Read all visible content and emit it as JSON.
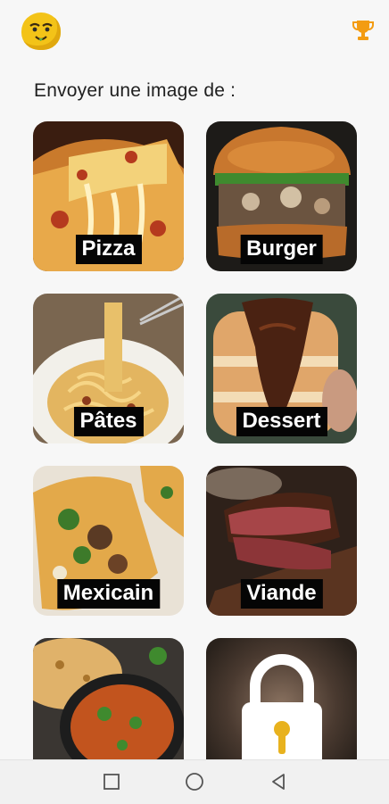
{
  "header": {
    "avatar_icon": "emoji-face-icon",
    "trophy_icon": "trophy-icon",
    "accent_color": "#f39c12"
  },
  "heading": "Envoyer une image de :",
  "categories": [
    {
      "label": "Pizza",
      "locked": false
    },
    {
      "label": "Burger",
      "locked": false
    },
    {
      "label": "Pâtes",
      "locked": false
    },
    {
      "label": "Dessert",
      "locked": false
    },
    {
      "label": "Mexicain",
      "locked": false
    },
    {
      "label": "Viande",
      "locked": false
    },
    {
      "label": "",
      "locked": false
    },
    {
      "label": "",
      "locked": true
    }
  ],
  "navbar": {
    "items": [
      "recent-apps-icon",
      "home-icon",
      "back-icon"
    ]
  }
}
